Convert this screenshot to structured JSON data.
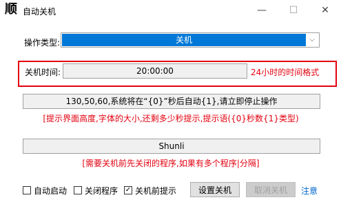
{
  "window": {
    "app_glyph": "顺",
    "title": "自动关机",
    "minimize": "—",
    "maximize": "☐",
    "close": "✕"
  },
  "operation": {
    "label": "操作类型:",
    "selected": "关机",
    "arrow": "⌵"
  },
  "shutdown_time": {
    "label": "关机时间:",
    "value": "20:00:00",
    "hint": "24小时的时间格式"
  },
  "prompt": {
    "value": "130,50,60,系统将在“{0}”秒后自动{1},请立即停止操作",
    "hint": "[提示界面高度,字体的大小,还剩多少秒提示,提示语({0}秒数{1}类型)"
  },
  "programs": {
    "value": "Shunli",
    "hint": "[需要关机前先关闭的程序,如果有多个程序|分隔]"
  },
  "options": {
    "auto_start": {
      "label": "自动启动",
      "checked": false
    },
    "close_programs": {
      "label": "关闭程序",
      "checked": false
    },
    "prompt_before": {
      "label": "关机前提示",
      "checked": true
    }
  },
  "buttons": {
    "set_shutdown": "设置关机",
    "cancel_shutdown": "取消关机",
    "note": "注意"
  },
  "colors": {
    "accent": "#0078d7",
    "hint_red": "#e3000f",
    "link_blue": "#0066cc"
  }
}
